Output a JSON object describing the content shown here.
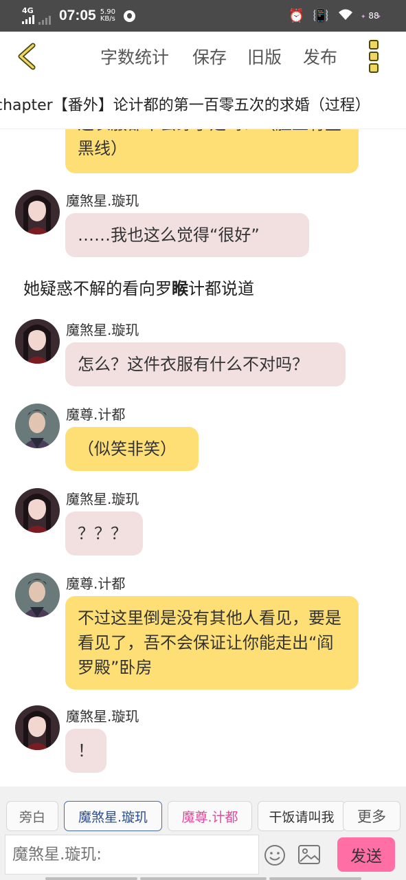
{
  "status_bar": {
    "network": "4G",
    "time": "07:05",
    "speed_value": "5.90",
    "speed_unit": "KB/s",
    "battery": "88",
    "icons": [
      "alarm-icon",
      "vibrate-icon",
      "wifi-icon"
    ]
  },
  "toolbar": {
    "back_icon": "chevron-left-icon",
    "items": [
      "字数统计",
      "保存",
      "旧版",
      "发布"
    ],
    "more_icon": "more-vertical-icon"
  },
  "chapter": {
    "title": "chapter【番外】论计都的第一百零五次的求婚（过程）"
  },
  "messages": [
    {
      "type": "bubble",
      "sender": "",
      "style": "yellow",
      "text": "这衣服都不会穿了是吗？（脸上有些黑线）"
    },
    {
      "type": "bubble",
      "sender": "魔煞星.璇玑",
      "style": "pink",
      "text": "……我也这么觉得“很好”"
    },
    {
      "type": "narration",
      "pre": "她疑惑不解的看向罗",
      "bold": "睺",
      "post": "计都说道"
    },
    {
      "type": "bubble",
      "sender": "魔煞星.璇玑",
      "style": "pink",
      "text": "怎么？这件衣服有什么不对吗？"
    },
    {
      "type": "bubble",
      "sender": "魔尊.计都",
      "style": "yellow",
      "text": "（似笑非笑）"
    },
    {
      "type": "bubble",
      "sender": "魔煞星.璇玑",
      "style": "pink",
      "text": "？？？"
    },
    {
      "type": "bubble",
      "sender": "魔尊.计都",
      "style": "yellow",
      "text": "不过这里倒是没有其他人看见，要是看见了，吾不会保证让你能走出“阎罗殿”卧房"
    },
    {
      "type": "bubble",
      "sender": "魔煞星.璇玑",
      "style": "pink",
      "text": "！"
    }
  ],
  "roles": [
    "旁白",
    "魔煞星.璇玑",
    "魔尊.计都",
    "干饭请叫我",
    "更多"
  ],
  "input": {
    "placeholder": "魔煞星.璇玑:",
    "emoji_icon": "emoji-icon",
    "image_icon": "image-icon",
    "send_label": "发送"
  },
  "colors": {
    "pink_bubble": "#f2e0e0",
    "yellow_bubble": "#fedf76",
    "send_button": "#ff6fa5",
    "active_role_border": "#4a6aa2",
    "accent_role_text": "#e0499b"
  }
}
